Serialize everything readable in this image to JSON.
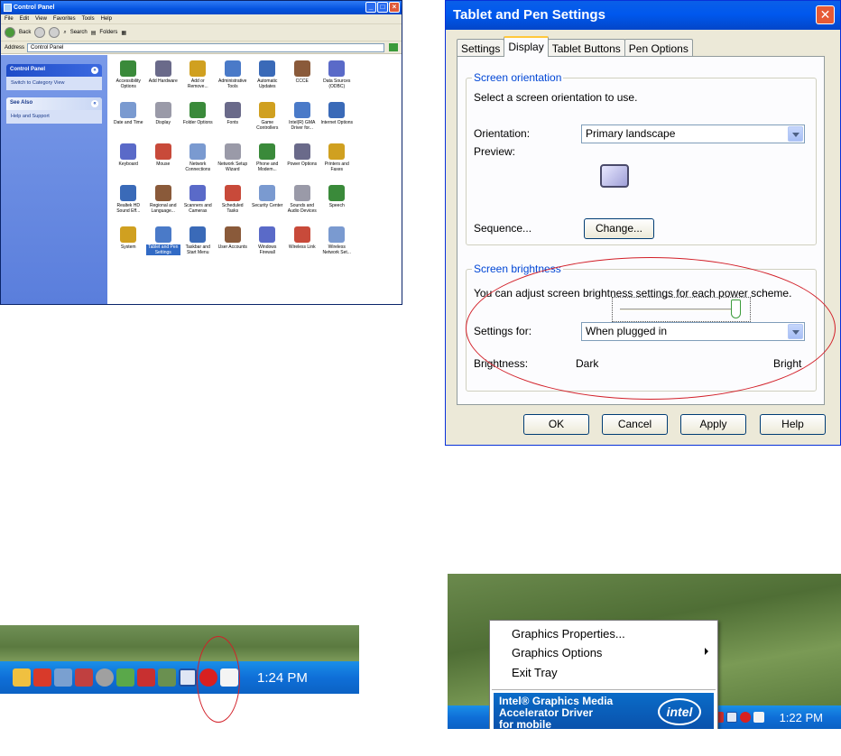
{
  "control_panel": {
    "title": "Control Panel",
    "menu": [
      "File",
      "Edit",
      "View",
      "Favorites",
      "Tools",
      "Help"
    ],
    "toolbar": {
      "back": "Back",
      "search": "Search",
      "folders": "Folders"
    },
    "address_label": "Address",
    "address_value": "Control Panel",
    "sidebar": {
      "panel_title": "Control Panel",
      "switch_view": "Switch to Category View",
      "see_also_title": "See Also",
      "help_link": "Help and Support"
    },
    "items": [
      "Accessibility Options",
      "Add Hardware",
      "Add or Remove...",
      "Administrative Tools",
      "Automatic Updates",
      "CCCE",
      "Data Sources (ODBC)",
      "",
      "Date and Time",
      "Display",
      "Folder Options",
      "Fonts",
      "Game Controllers",
      "Intel(R) GMA Driver for...",
      "Internet Options",
      "",
      "Keyboard",
      "Mouse",
      "Network Connections",
      "Network Setup Wizard",
      "Phone and Modem...",
      "Power Options",
      "Printers and Faxes",
      "",
      "Realtek HD Sound Eff...",
      "Regional and Language...",
      "Scanners and Cameras",
      "Scheduled Tasks",
      "Security Center",
      "Sounds and Audio Devices",
      "Speech",
      "",
      "System",
      "Tablet and Pen Settings",
      "Taskbar and Start Menu",
      "User Accounts",
      "Windows Firewall",
      "Wireless Link",
      "Wireless Network Set...",
      ""
    ],
    "selected_item": "Tablet and Pen Settings"
  },
  "tablet_dialog": {
    "title": "Tablet and Pen Settings",
    "tabs": [
      "Settings",
      "Display",
      "Tablet Buttons",
      "Pen Options"
    ],
    "active_tab": "Display",
    "orientation_group": "Screen orientation",
    "orientation_intro": "Select a screen orientation to use.",
    "orientation_label": "Orientation:",
    "orientation_value": "Primary landscape",
    "preview_label": "Preview:",
    "sequence_label": "Sequence...",
    "change_button": "Change...",
    "brightness_group": "Screen brightness",
    "brightness_intro": "You can adjust screen brightness settings for each power scheme.",
    "settings_for_label": "Settings for:",
    "settings_for_value": "When plugged in",
    "brightness_label": "Brightness:",
    "dark_label": "Dark",
    "bright_label": "Bright",
    "brightness_level": 1.0,
    "buttons": {
      "ok": "OK",
      "cancel": "Cancel",
      "apply": "Apply",
      "help": "Help"
    }
  },
  "taskbar_1": {
    "clock": "1:24 PM"
  },
  "tray_menu": {
    "items": [
      "Graphics Properties...",
      "Graphics Options",
      "Exit Tray"
    ],
    "banner_line1": "Intel® Graphics Media",
    "banner_line2": "Accelerator Driver",
    "banner_line3": "for mobile",
    "logo_text": "intel",
    "clock": "1:22 PM"
  },
  "colors": {
    "xp_title_blue": "#0058ee",
    "group_legend_blue": "#0046d5",
    "annotation_red": "#d21f28",
    "taskbar_blue": "#0f6fd8",
    "intel_blue": "#0a5cb8"
  }
}
